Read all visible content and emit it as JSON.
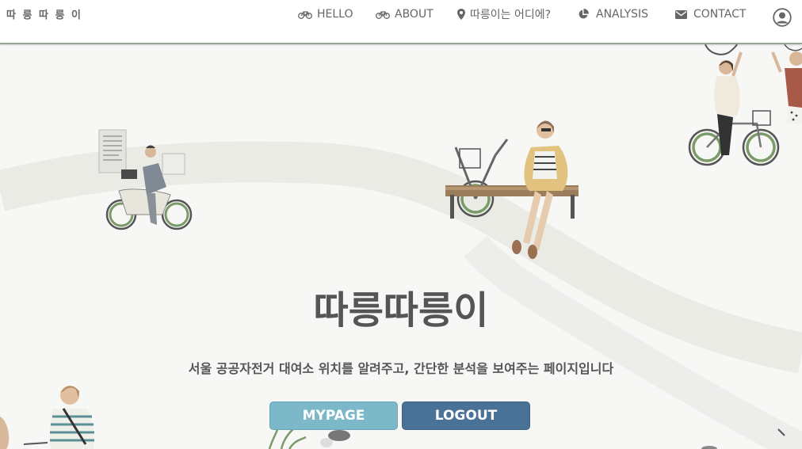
{
  "brand": "따 릉 따 릉 이",
  "nav": {
    "hello": "HELLO",
    "about": "ABOUT",
    "where": "따릉이는 어디에?",
    "analysis": "ANALYSIS",
    "contact": "CONTACT"
  },
  "icons": {
    "hello": "bicycle-icon",
    "about": "bicycle-icon",
    "where": "map-marker-icon",
    "analysis": "pie-chart-icon",
    "contact": "envelope-icon",
    "profile": "user-circle-icon"
  },
  "hero": {
    "title": "따릉따릉이",
    "subtitle": "서울 공공자전거 대여소 위치를 알려주고, 간단한 분석을 보여주는 페이지입니다"
  },
  "buttons": {
    "mypage": "MYPAGE",
    "logout": "LOGOUT"
  },
  "colors": {
    "mypage": "#7db8c9",
    "logout": "#4a7296",
    "road": "#ebebe6",
    "bike_green": "#6f8f5e"
  }
}
